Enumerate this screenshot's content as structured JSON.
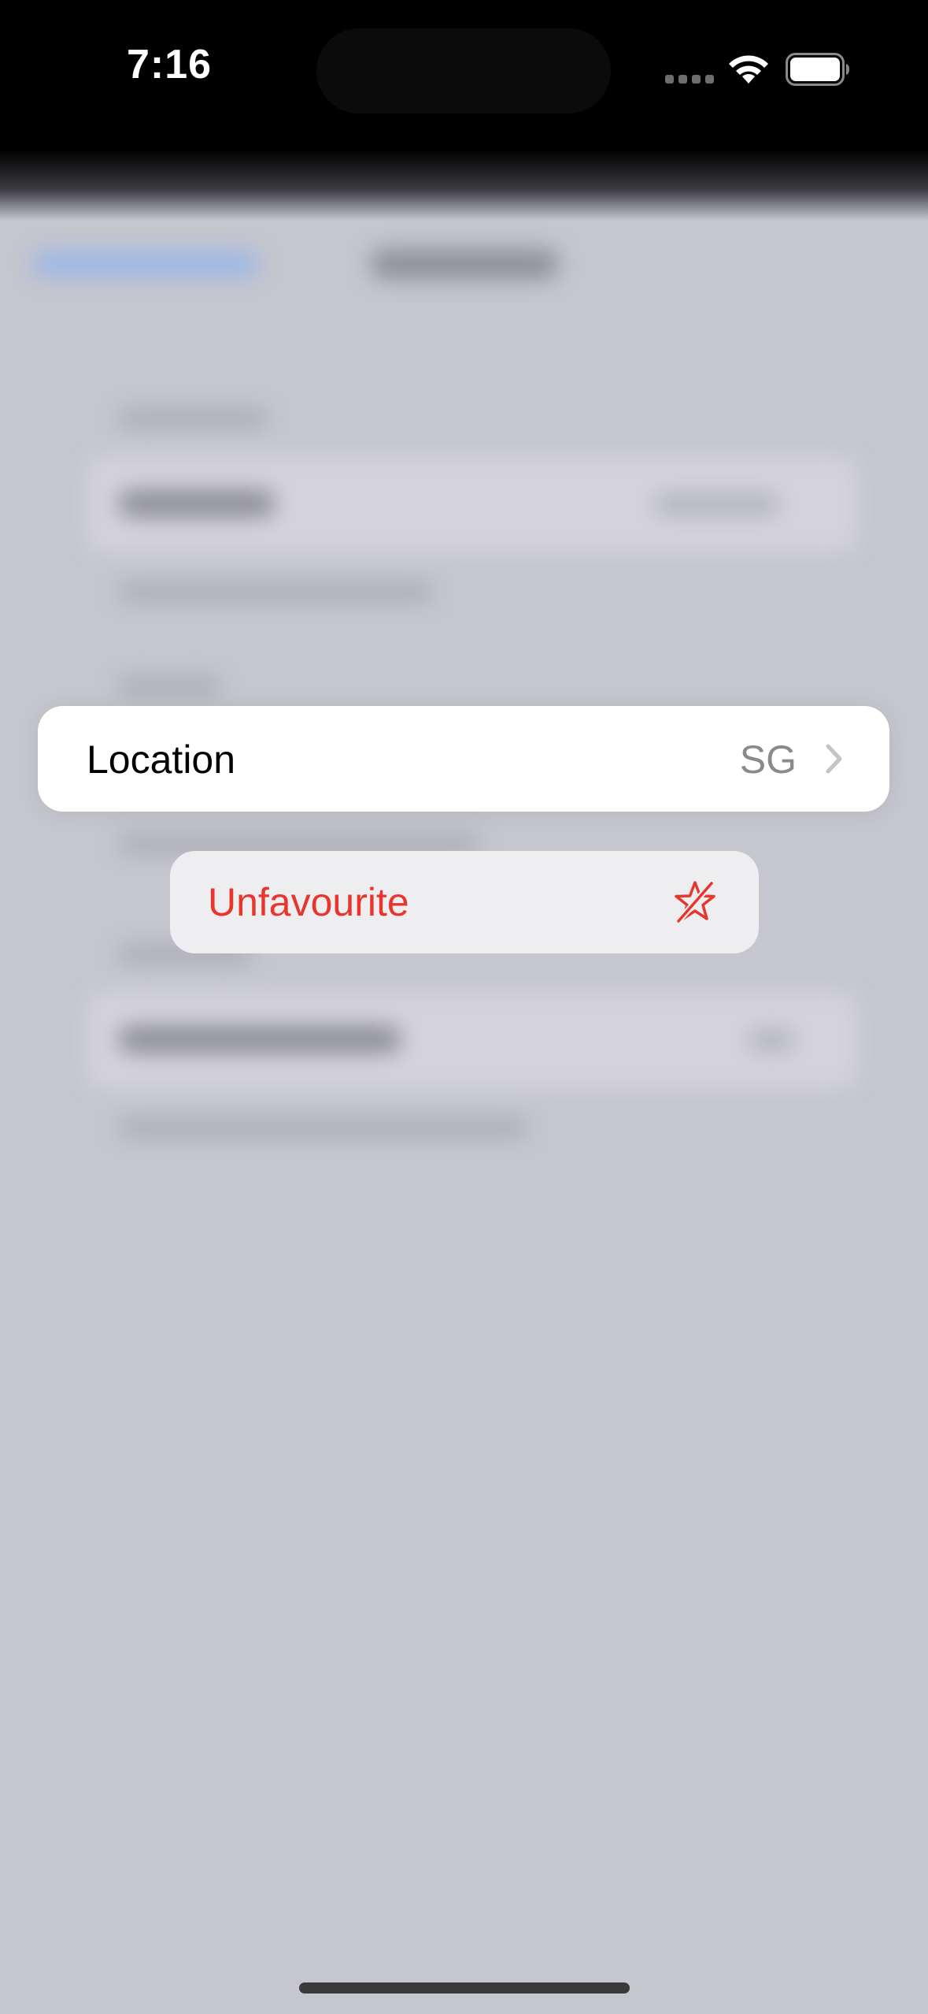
{
  "status_bar": {
    "time": "7:16"
  },
  "focused_row": {
    "label": "Location",
    "value": "SG"
  },
  "context_menu": {
    "items": [
      {
        "label": "Unfavourite",
        "icon": "star-slash-icon",
        "color": "#e8352e"
      }
    ]
  }
}
